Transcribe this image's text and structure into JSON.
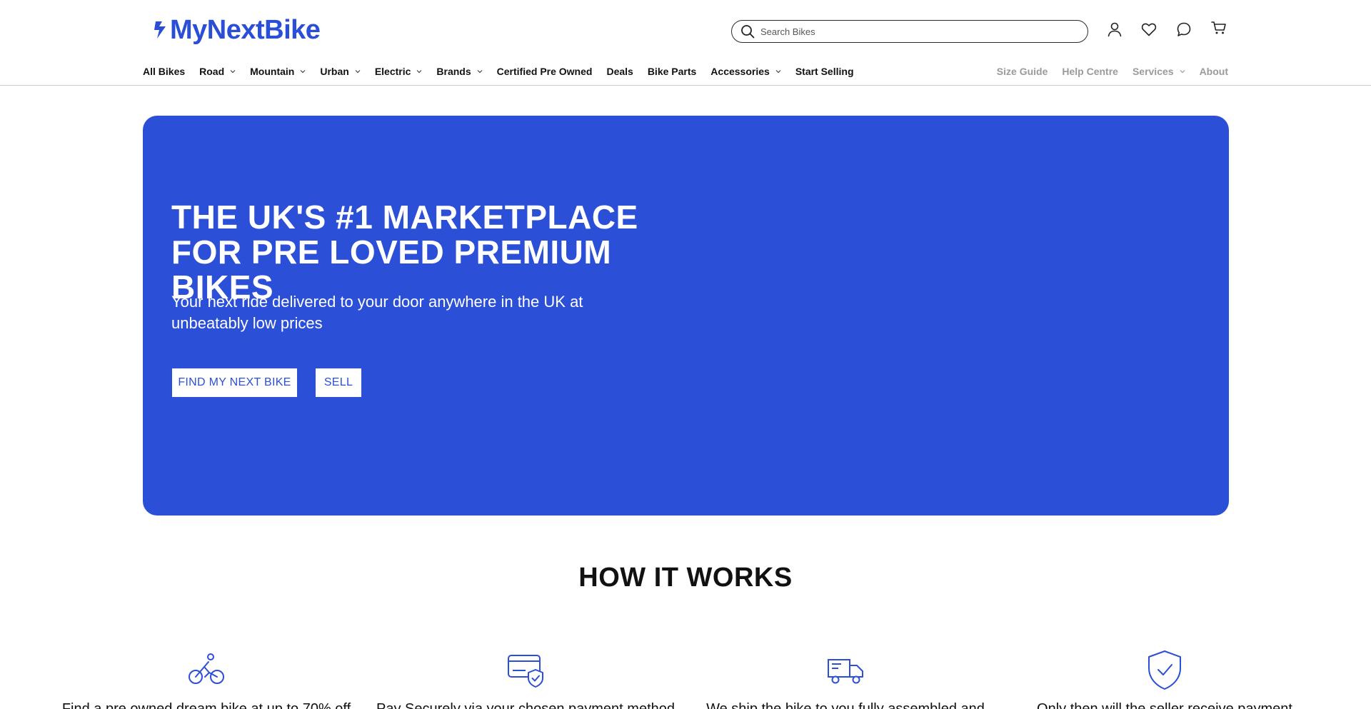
{
  "brand": {
    "logo_text": "MyNextBike",
    "accent_color": "#2b4fd6"
  },
  "search": {
    "placeholder": "Search Bikes"
  },
  "header_icons": [
    "user-icon",
    "heart-icon",
    "chat-icon",
    "cart-icon"
  ],
  "nav": {
    "left": [
      {
        "label": "All Bikes",
        "dropdown": false
      },
      {
        "label": "Road",
        "dropdown": true
      },
      {
        "label": "Mountain",
        "dropdown": true
      },
      {
        "label": "Urban",
        "dropdown": true
      },
      {
        "label": "Electric",
        "dropdown": true
      },
      {
        "label": "Brands",
        "dropdown": true
      },
      {
        "label": "Certified Pre Owned",
        "dropdown": false
      },
      {
        "label": "Deals",
        "dropdown": false
      },
      {
        "label": "Bike Parts",
        "dropdown": false
      },
      {
        "label": "Accessories",
        "dropdown": true
      },
      {
        "label": "Start Selling",
        "dropdown": false
      }
    ],
    "right": [
      {
        "label": "Size Guide",
        "dropdown": false
      },
      {
        "label": "Help Centre",
        "dropdown": false
      },
      {
        "label": "Services",
        "dropdown": true
      },
      {
        "label": "About",
        "dropdown": false
      }
    ]
  },
  "hero": {
    "title": "THE UK'S #1 MARKETPLACE FOR PRE LOVED PREMIUM BIKES",
    "subtitle": "Your next ride delivered to your door anywhere in the UK at unbeatably low prices",
    "primary_button": "FIND MY NEXT BIKE",
    "secondary_button": "SELL"
  },
  "how_it_works": {
    "title": "HOW IT WORKS",
    "steps": [
      {
        "icon": "bike-icon",
        "text": "Find a pre owned dream bike at up to 70% off"
      },
      {
        "icon": "secure-card-icon",
        "text": "Pay Securely via your chosen payment method"
      },
      {
        "icon": "truck-icon",
        "text": "We ship the bike to you fully assembled and"
      },
      {
        "icon": "shield-check-icon",
        "text": "Only then will the seller receive payment"
      }
    ]
  }
}
